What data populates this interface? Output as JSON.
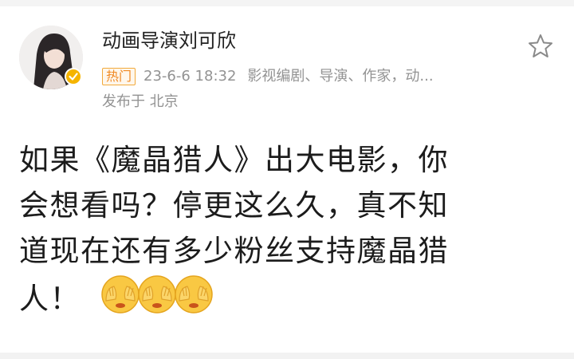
{
  "post": {
    "author": {
      "name": "动画导演刘可欣",
      "verified": true,
      "avatar_icon": "avatar-portrait"
    },
    "hot_tag": "热门",
    "date": "23-6-6 18:32",
    "bio": "影视编剧、导演、作家，动...",
    "location": "发布于 北京",
    "favorite_icon": "star-outline-icon",
    "content_lines": [
      "如果《魔晶猎人》出大电影，你",
      "会想看吗？停更这么久，真不知",
      "道现在还有多少粉丝支持魔晶猎",
      "人！"
    ],
    "emojis": [
      "cover-face-emoji",
      "cover-face-emoji",
      "cover-face-emoji"
    ]
  },
  "colors": {
    "hot_tag": "#f08a24",
    "meta": "#939393",
    "text": "#1c1c1c",
    "verified": "#f5b400"
  }
}
